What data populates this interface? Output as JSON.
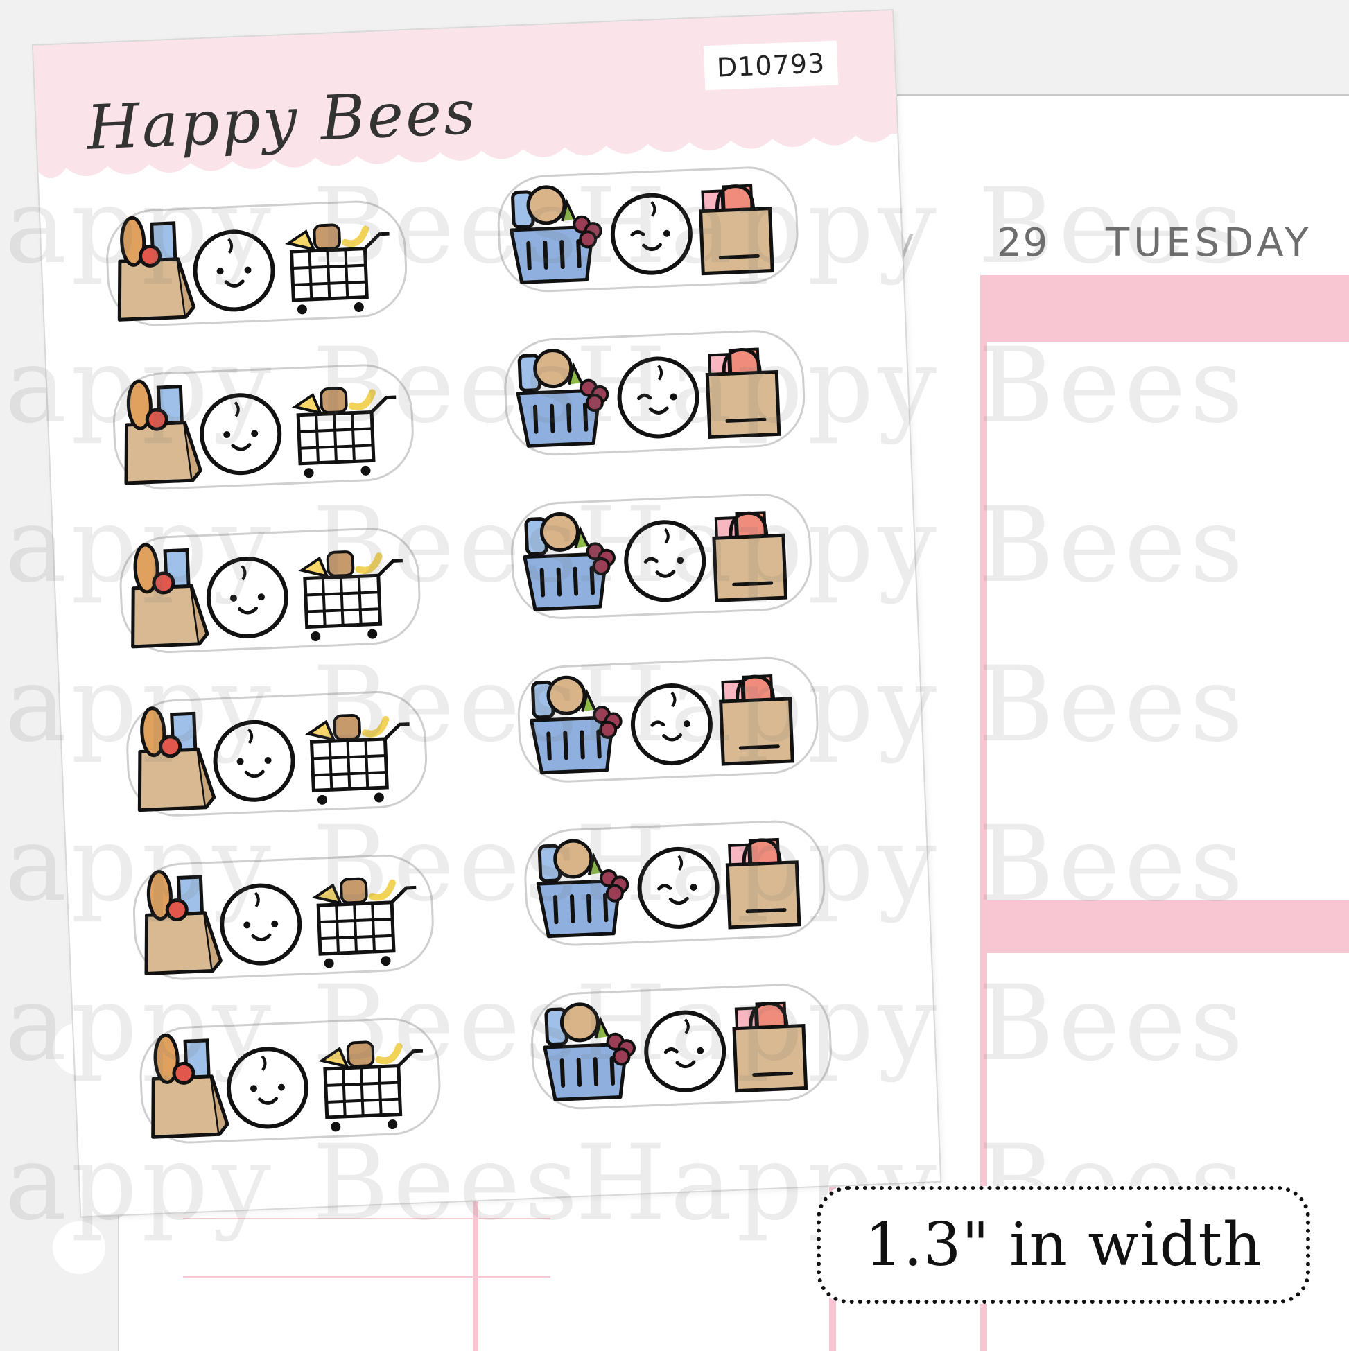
{
  "brand": {
    "name": "Happy Bees",
    "product_code": "D10793"
  },
  "planner": {
    "day_number": "29",
    "day_name": "TUESDAY",
    "partial_text": "y"
  },
  "watermark": {
    "text": "Happy Bees"
  },
  "size_note": "1.3\" in width",
  "stickers": {
    "left_column": [
      "grocery-bag-face-cart",
      "grocery-bag-face-cart",
      "grocery-bag-face-cart",
      "grocery-bag-face-cart",
      "grocery-bag-face-cart",
      "grocery-bag-face-cart"
    ],
    "right_column": [
      "basket-winking-face-shopping-bag",
      "basket-winking-face-shopping-bag",
      "basket-winking-face-shopping-bag",
      "basket-winking-face-shopping-bag",
      "basket-winking-face-shopping-bag",
      "basket-winking-face-shopping-bag"
    ]
  },
  "colors": {
    "header_pink": "#fbe3ea",
    "planner_pink": "#f7c6d2",
    "kraft": "#d8b992",
    "basket_blue": "#8fb0df",
    "outline": "#111111"
  }
}
